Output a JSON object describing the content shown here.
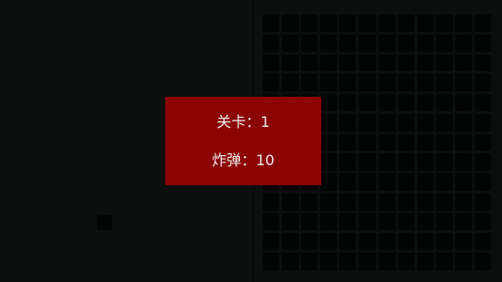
{
  "dialog": {
    "level_label": "关卡",
    "level_separator": "：",
    "level_value": "1",
    "bombs_label": "炸弹",
    "bombs_separator": "：",
    "bombs_value": "10"
  },
  "colors": {
    "background": "#0b100e",
    "board_cell": "#030404",
    "dialog_bg": "#8b0303",
    "dialog_text": "#f2eded"
  },
  "board": {
    "columns": 12,
    "rows": 13
  }
}
